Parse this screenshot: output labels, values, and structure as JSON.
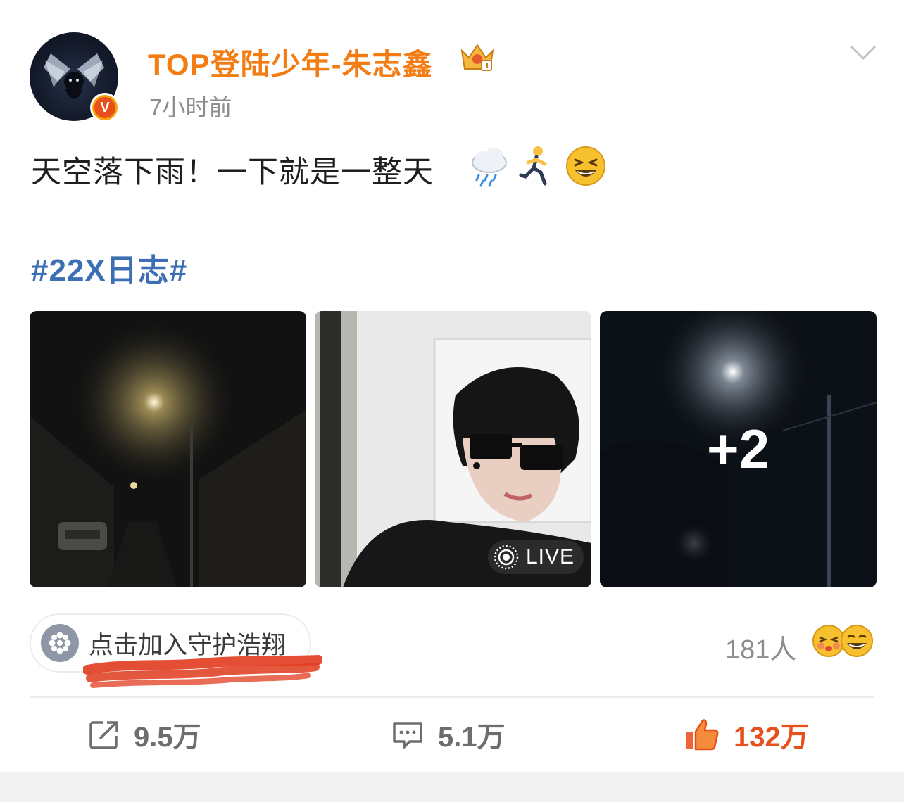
{
  "post": {
    "username": "TOP登陆少年-朱志鑫",
    "time": "7小时前",
    "text": "天空落下雨！一下就是一整天",
    "emojis": [
      "rain-cloud",
      "runner",
      "laughing-face"
    ],
    "hashtag": "#22X日志#",
    "verified_badge": "V"
  },
  "media": {
    "live_label": "LIVE",
    "more_count": "+2"
  },
  "guard": {
    "label": "点击加入守护浩翔",
    "fans_count": "181人"
  },
  "actions": {
    "repost_count": "9.5万",
    "comment_count": "5.1万",
    "like_count": "132万"
  },
  "colors": {
    "username": "#f37c13",
    "hashtag": "#3d6fb5",
    "like": "#e8501b",
    "muted": "#8d8d8d"
  }
}
